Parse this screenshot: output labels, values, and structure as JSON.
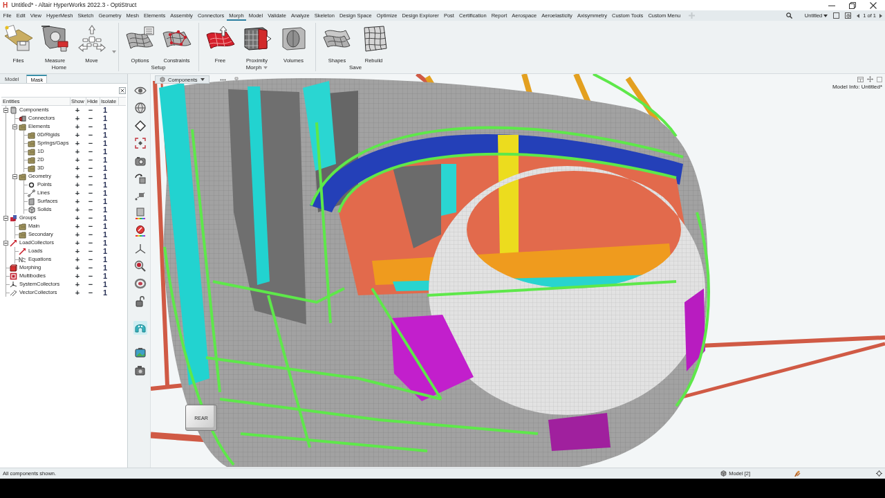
{
  "window": {
    "logo": "H",
    "title": "Untitled* - Altair HyperWorks 2022.3 - OptiStruct"
  },
  "menu_bar": {
    "items": [
      {
        "label": "File",
        "selected": false
      },
      {
        "label": "Edit",
        "selected": false
      },
      {
        "label": "View",
        "selected": false
      },
      {
        "label": "HyperMesh",
        "selected": false
      },
      {
        "label": "Sketch",
        "selected": false
      },
      {
        "label": "Geometry",
        "selected": false
      },
      {
        "label": "Mesh",
        "selected": false
      },
      {
        "label": "Elements",
        "selected": false
      },
      {
        "label": "Assembly",
        "selected": false
      },
      {
        "label": "Connectors",
        "selected": false
      },
      {
        "label": "Morph",
        "selected": true
      },
      {
        "label": "Model",
        "selected": false
      },
      {
        "label": "Validate",
        "selected": false
      },
      {
        "label": "Analyze",
        "selected": false
      },
      {
        "label": "Skeleton",
        "selected": false
      },
      {
        "label": "Design Space",
        "selected": false
      },
      {
        "label": "Optimize",
        "selected": false
      },
      {
        "label": "Design Explorer",
        "selected": false
      },
      {
        "label": "Post",
        "selected": false
      },
      {
        "label": "Certification",
        "selected": false
      },
      {
        "label": "Report",
        "selected": false
      },
      {
        "label": "Aerospace",
        "selected": false
      },
      {
        "label": "Aeroelasticity",
        "selected": false
      },
      {
        "label": "Axisymmetry",
        "selected": false
      },
      {
        "label": "Custom Tools",
        "selected": false
      },
      {
        "label": "Custom Menu",
        "selected": false
      }
    ],
    "session": "Untitled",
    "page": "1 of 1"
  },
  "ribbon": {
    "groups": [
      {
        "label": "Home",
        "menu": false,
        "tools": [
          {
            "label": "Files",
            "menu": false
          },
          {
            "label": "Measure",
            "menu": false
          },
          {
            "label": "Move",
            "menu": true
          }
        ]
      },
      {
        "label": "Setup",
        "menu": false,
        "tools": [
          {
            "label": "Options",
            "menu": false
          },
          {
            "label": "Constraints",
            "menu": false
          }
        ]
      },
      {
        "label": "Morph",
        "menu": true,
        "tools": [
          {
            "label": "Free",
            "menu": false
          },
          {
            "label": "Proximity",
            "menu": false
          },
          {
            "label": "Volumes",
            "menu": false
          }
        ]
      },
      {
        "label": "Save",
        "menu": false,
        "tools": [
          {
            "label": "Shapes",
            "menu": false
          },
          {
            "label": "Rebuild",
            "menu": false
          }
        ]
      }
    ]
  },
  "side_panel": {
    "tabs": [
      {
        "label": "Model",
        "selected": false
      },
      {
        "label": "Mask",
        "selected": true
      }
    ],
    "columns": [
      "Entities",
      "Show",
      "Hide",
      "Isolate"
    ],
    "tree": [
      {
        "label": "Components",
        "expanded": true,
        "show": "+",
        "hide": "−",
        "isolate": "1",
        "children": [
          {
            "label": "Connectors",
            "show": "+",
            "hide": "−",
            "isolate": "1"
          },
          {
            "label": "Elements",
            "expanded": true,
            "show": "+",
            "hide": "−",
            "isolate": "1",
            "children": [
              {
                "label": "0D/Rigids",
                "show": "+",
                "hide": "−",
                "isolate": "1"
              },
              {
                "label": "Springs/Gaps",
                "show": "+",
                "hide": "−",
                "isolate": "1"
              },
              {
                "label": "1D",
                "show": "+",
                "hide": "−",
                "isolate": "1"
              },
              {
                "label": "2D",
                "show": "+",
                "hide": "−",
                "isolate": "1"
              },
              {
                "label": "3D",
                "show": "+",
                "hide": "−",
                "isolate": "1"
              }
            ]
          },
          {
            "label": "Geometry",
            "expanded": true,
            "show": "+",
            "hide": "−",
            "isolate": "1",
            "children": [
              {
                "label": "Points",
                "show": "+",
                "hide": "−",
                "isolate": "1"
              },
              {
                "label": "Lines",
                "show": "+",
                "hide": "−",
                "isolate": "1"
              },
              {
                "label": "Surfaces",
                "show": "+",
                "hide": "−",
                "isolate": "1"
              },
              {
                "label": "Solids",
                "show": "+",
                "hide": "−",
                "isolate": "1"
              }
            ]
          }
        ]
      },
      {
        "label": "Groups",
        "expanded": true,
        "show": "+",
        "hide": "−",
        "isolate": "1",
        "children": [
          {
            "label": "Main",
            "show": "+",
            "hide": "−",
            "isolate": "1"
          },
          {
            "label": "Secondary",
            "show": "+",
            "hide": "−",
            "isolate": "1"
          }
        ]
      },
      {
        "label": "LoadCollectors",
        "expanded": true,
        "show": "+",
        "hide": "−",
        "isolate": "1",
        "children": [
          {
            "label": "Loads",
            "show": "+",
            "hide": "−",
            "isolate": "1"
          },
          {
            "label": "Equations",
            "show": "+",
            "hide": "−",
            "isolate": "1"
          }
        ]
      },
      {
        "label": "Morphing",
        "show": "+",
        "hide": "−",
        "isolate": "1"
      },
      {
        "label": "Multibodies",
        "show": "+",
        "hide": "−",
        "isolate": "1"
      },
      {
        "label": "SystemCollectors",
        "show": "+",
        "hide": "−",
        "isolate": "1"
      },
      {
        "label": "VectorCollectors",
        "show": "+",
        "hide": "−",
        "isolate": "1"
      }
    ]
  },
  "view_toolbar": {
    "tools": [
      {
        "selected": false
      },
      {
        "selected": false
      },
      {
        "selected": false
      },
      {
        "selected": false
      },
      {
        "selected": false
      },
      {
        "selected": false
      },
      {
        "selected": false
      },
      {
        "selected": false
      },
      {
        "selected": false
      },
      {
        "selected": false
      },
      {
        "selected": false
      },
      {
        "selected": false
      },
      {
        "selected": false
      },
      {
        "selected": true
      },
      {
        "selected": false
      },
      {
        "selected": false
      }
    ]
  },
  "viewport": {
    "view_menu": "Components",
    "model_info": "Model Info: Untitled*",
    "view_cube": "REAR"
  },
  "status_bar": {
    "message": "All components shown.",
    "model": "Model [2]"
  }
}
